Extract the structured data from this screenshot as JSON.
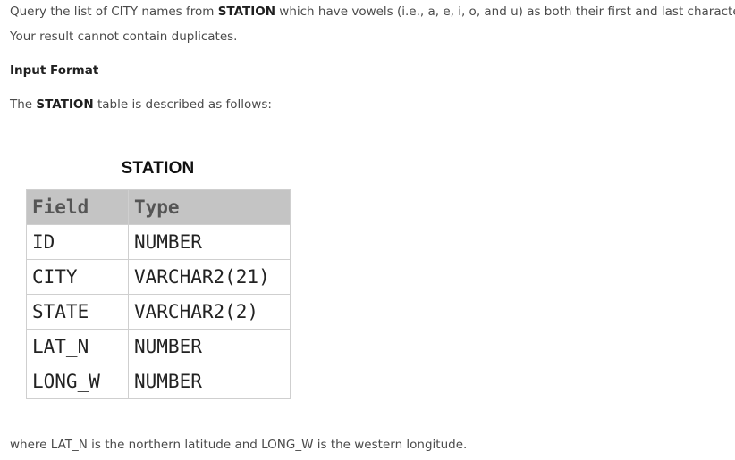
{
  "problem": {
    "line1": {
      "before": "Query the list of CITY names from ",
      "bold": "STATION",
      "after": " which have vowels (i.e., a, e, i, o, and u) as both their first and last characters."
    },
    "line2": "Your result cannot contain duplicates.",
    "input_format_heading": "Input Format",
    "line4": {
      "before": "The ",
      "bold": "STATION",
      "after": " table is described as follows:"
    },
    "footer": "where LAT_N is the northern latitude and LONG_W is the western longitude."
  },
  "table": {
    "caption": "STATION",
    "headers": [
      "Field",
      "Type"
    ],
    "rows": [
      [
        "ID",
        "NUMBER"
      ],
      [
        "CITY",
        "VARCHAR2(21)"
      ],
      [
        "STATE",
        "VARCHAR2(2)"
      ],
      [
        "LAT_N",
        "NUMBER"
      ],
      [
        "LONG_W",
        "NUMBER"
      ]
    ]
  }
}
